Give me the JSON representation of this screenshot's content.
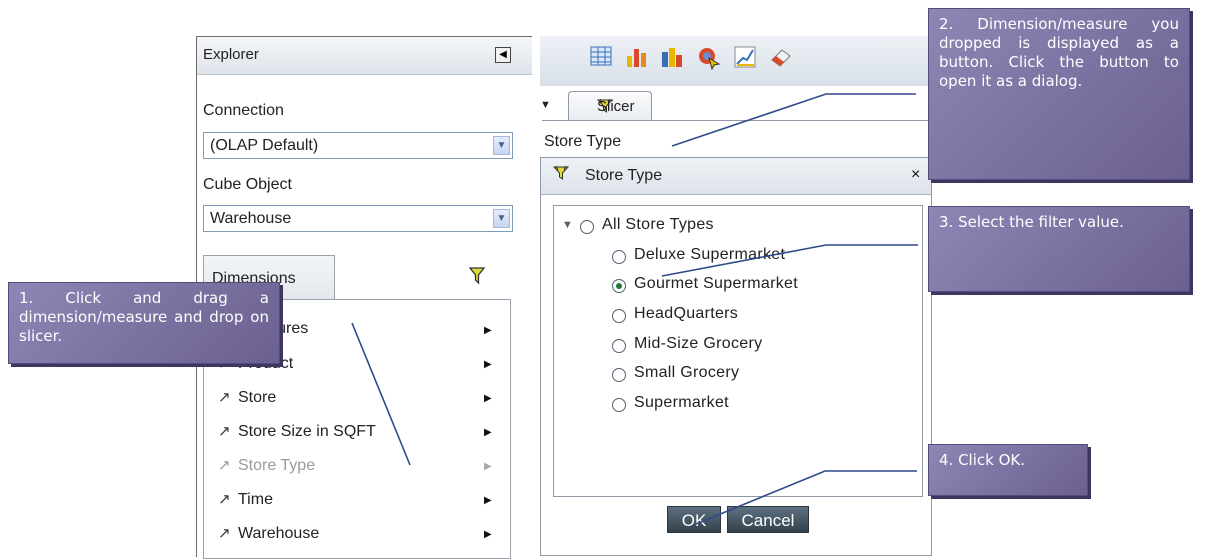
{
  "explorer": {
    "title": "Explorer",
    "collapse_symbol": "◀",
    "connection_label": "Connection",
    "connection_value": "(OLAP Default)",
    "cube_label": "Cube Object",
    "cube_value": "Warehouse",
    "dimensions_tab": "Dimensions",
    "filter_icon": "filter-icon",
    "dimensions": [
      {
        "label": "Measures",
        "icon": "none"
      },
      {
        "label": "Product",
        "icon": "hierarchy-icon"
      },
      {
        "label": "Store",
        "icon": "hierarchy-icon"
      },
      {
        "label": "Store Size in SQFT",
        "icon": "hierarchy-icon"
      },
      {
        "label": "Store Type",
        "icon": "hierarchy-icon",
        "disabled": true
      },
      {
        "label": "Time",
        "icon": "hierarchy-icon"
      },
      {
        "label": "Warehouse",
        "icon": "hierarchy-icon"
      }
    ]
  },
  "toolbar": {
    "icons": [
      "table-icon",
      "bar-chart-icon",
      "column-chart-icon",
      "pointer-icon",
      "line-chart-icon",
      "eraser-icon"
    ]
  },
  "slicer": {
    "tab_label": "Slicer",
    "dimension_button": "Store Type"
  },
  "dialog": {
    "title": "Store Type",
    "close": "×",
    "root_option": "All Store Types",
    "options": [
      {
        "label": "Deluxe Supermarket",
        "selected": false
      },
      {
        "label": "Gourmet Supermarket",
        "selected": true
      },
      {
        "label": "HeadQuarters",
        "selected": false
      },
      {
        "label": "Mid-Size Grocery",
        "selected": false
      },
      {
        "label": "Small Grocery",
        "selected": false
      },
      {
        "label": "Supermarket",
        "selected": false
      }
    ],
    "ok_label": "OK",
    "cancel_label": "Cancel"
  },
  "callouts": {
    "step1": "1. Click and drag a dimension/measure and drop on slicer.",
    "step2": "2. Dimension/measure you dropped is displayed as a button. Click the button to open it as a dialog.",
    "step3": "3. Select the filter value.",
    "step4": "4. Click OK."
  },
  "colors": {
    "callout": "#7a709f",
    "button": "#3f4f5c",
    "selected_radio": "#1f7a3a"
  }
}
